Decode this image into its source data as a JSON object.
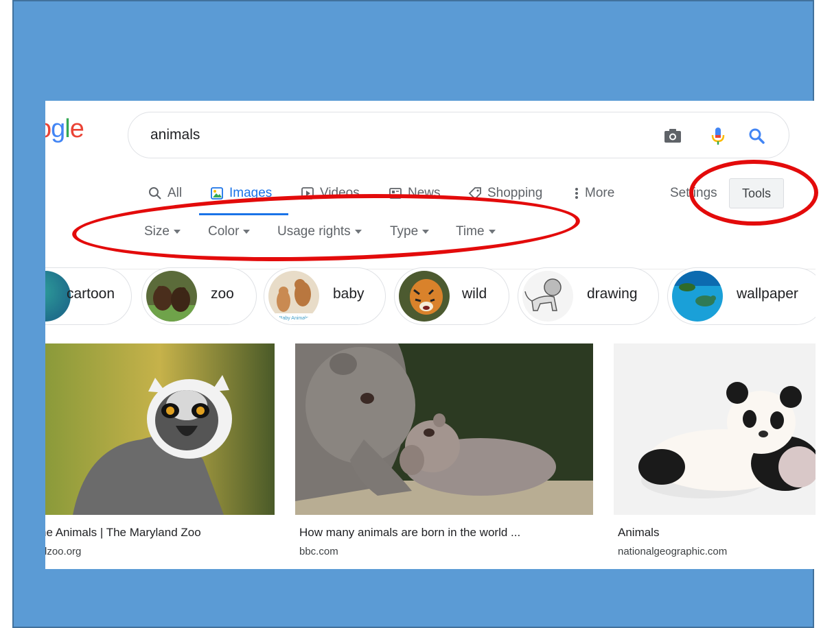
{
  "logo": {
    "text": "ogle"
  },
  "search": {
    "query": "animals",
    "icons": [
      "camera-icon",
      "microphone-icon",
      "search-icon"
    ]
  },
  "tabs": [
    {
      "label": "All",
      "icon": "search-icon"
    },
    {
      "label": "Images",
      "icon": "image-icon"
    },
    {
      "label": "Videos",
      "icon": "play-icon"
    },
    {
      "label": "News",
      "icon": "news-icon"
    },
    {
      "label": "Shopping",
      "icon": "tag-icon"
    },
    {
      "label": "More",
      "icon": "more-vertical-icon"
    }
  ],
  "settings_label": "Settings",
  "tools_label": "Tools",
  "filters": [
    "Size",
    "Color",
    "Usage rights",
    "Type",
    "Time"
  ],
  "chips": [
    {
      "label": "cartoon"
    },
    {
      "label": "zoo"
    },
    {
      "label": "baby",
      "thumb_caption": "Baby Animals"
    },
    {
      "label": "wild"
    },
    {
      "label": "drawing"
    },
    {
      "label": "wallpaper"
    }
  ],
  "results": [
    {
      "title": "he Animals | The Maryland Zoo",
      "source": "dzoo.org"
    },
    {
      "title": "How many animals are born in the world ...",
      "source": "bbc.com"
    },
    {
      "title": "Animals",
      "source": "nationalgeographic.com"
    }
  ],
  "colors": {
    "slide_bg": "#5b9bd5",
    "accent": "#1a73e8",
    "annotation": "#e30b0b"
  }
}
